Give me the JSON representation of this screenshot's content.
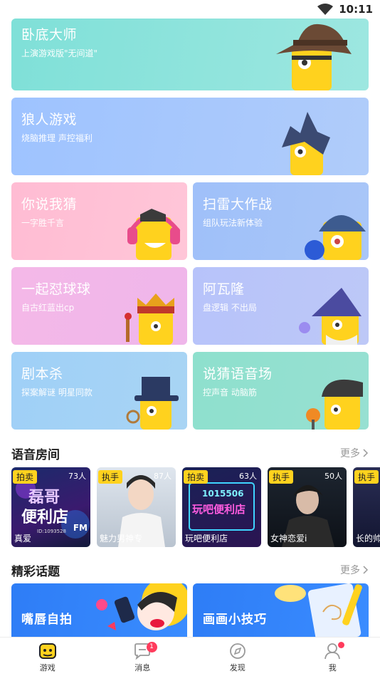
{
  "status_bar": {
    "time": "10:11"
  },
  "games": [
    {
      "title": "卧底大师",
      "subtitle": "上演游戏版\"无间道\""
    },
    {
      "title": "狼人游戏",
      "subtitle": "烧脑推理 声控福利"
    },
    {
      "title": "你说我猜",
      "subtitle": "一字胜千言"
    },
    {
      "title": "扫雷大作战",
      "subtitle": "组队玩法新体验"
    },
    {
      "title": "一起怼球球",
      "subtitle": "自古红蓝出cp"
    },
    {
      "title": "阿瓦隆",
      "subtitle": "盘逻辑 不出局"
    },
    {
      "title": "剧本杀",
      "subtitle": "探案解谜 明星同款"
    },
    {
      "title": "说猜语音场",
      "subtitle": "控声音 动脑筋"
    }
  ],
  "voice_rooms": {
    "title": "语音房间",
    "more": "更多",
    "rooms": [
      {
        "tag": "拍卖",
        "count": "73人",
        "name": "真爱",
        "poster_line1": "磊哥",
        "poster_line2": "便利店",
        "poster_small": "ID:1093528",
        "poster_fm": "FM"
      },
      {
        "tag": "执手",
        "count": "87人",
        "name": "魅力男神专"
      },
      {
        "tag": "拍卖",
        "count": "63人",
        "name": "玩吧便利店",
        "poster_line1": "1015506",
        "poster_line2": "玩吧便利店"
      },
      {
        "tag": "执手",
        "count": "50人",
        "name": "女神恋爱i"
      },
      {
        "tag": "执手",
        "count": "",
        "name": "长的帅"
      }
    ]
  },
  "topics": {
    "title": "精彩话题",
    "more": "更多",
    "items": [
      {
        "title": "嘴唇自拍"
      },
      {
        "title": "画画小技巧"
      }
    ]
  },
  "tabbar": {
    "items": [
      {
        "label": "游戏"
      },
      {
        "label": "消息",
        "badge": "1"
      },
      {
        "label": "发现"
      },
      {
        "label": "我"
      }
    ]
  },
  "colors": {
    "accent_yellow": "#ffd21e",
    "badge_red": "#ff3b5c"
  }
}
